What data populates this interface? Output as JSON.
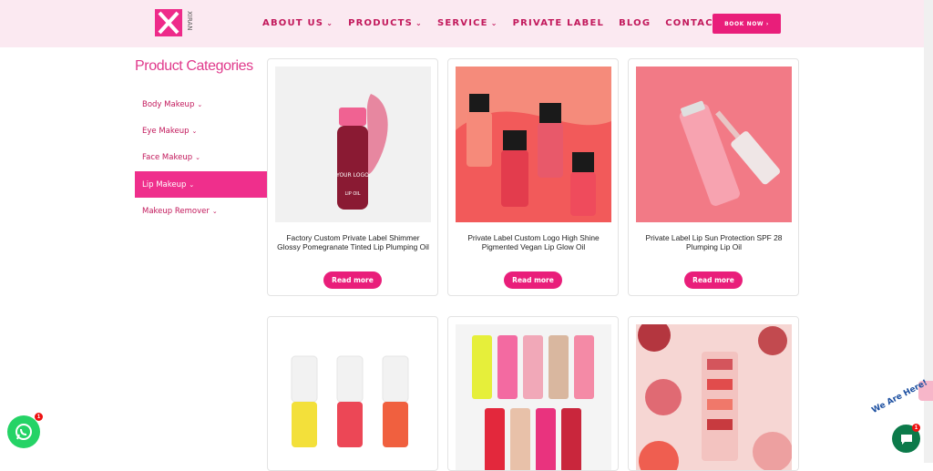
{
  "header": {
    "brand": "XIRAN",
    "nav": [
      {
        "label": "ABOUT US",
        "has_dropdown": true
      },
      {
        "label": "PRODUCTS",
        "has_dropdown": true
      },
      {
        "label": "SERVICE",
        "has_dropdown": true
      },
      {
        "label": "PRIVATE LABEL",
        "has_dropdown": false
      },
      {
        "label": "BLOG",
        "has_dropdown": false
      },
      {
        "label": "CONTACT US",
        "has_dropdown": false
      }
    ],
    "book_now": "BOOK NOW ›"
  },
  "sidebar": {
    "title": "Product Categories",
    "items": [
      {
        "label": "Body Makeup",
        "active": false
      },
      {
        "label": "Eye Makeup",
        "active": false
      },
      {
        "label": "Face Makeup",
        "active": false
      },
      {
        "label": "Lip Makeup",
        "active": true
      },
      {
        "label": "Makeup Remover",
        "active": false
      }
    ]
  },
  "products": [
    {
      "title": "Factory Custom Private Label Shimmer Glossy Pomegranate Tinted Lip Plumping Oil",
      "button": "Read more"
    },
    {
      "title": "Private Label Custom Logo High Shine Pigmented Vegan Lip Glow Oil",
      "button": "Read more"
    },
    {
      "title": "Private Label Lip Sun Protection SPF 28 Plumping Lip Oil",
      "button": "Read more"
    },
    {
      "title": "",
      "button": ""
    },
    {
      "title": "",
      "button": ""
    },
    {
      "title": "",
      "button": ""
    }
  ],
  "product_image_text": {
    "your_logo": "YOUR LOGO",
    "lip_oil": "LIP OIL"
  },
  "widgets": {
    "whatsapp_badge": "1",
    "chat_badge": "1",
    "chat_tagline": "We Are Here!"
  },
  "colors": {
    "accent": "#e91e7a",
    "header_bg": "#fbe9f1",
    "nav_text": "#c2185b"
  },
  "icons": [
    "chevron-down-icon",
    "whatsapp-icon",
    "chat-icon"
  ]
}
